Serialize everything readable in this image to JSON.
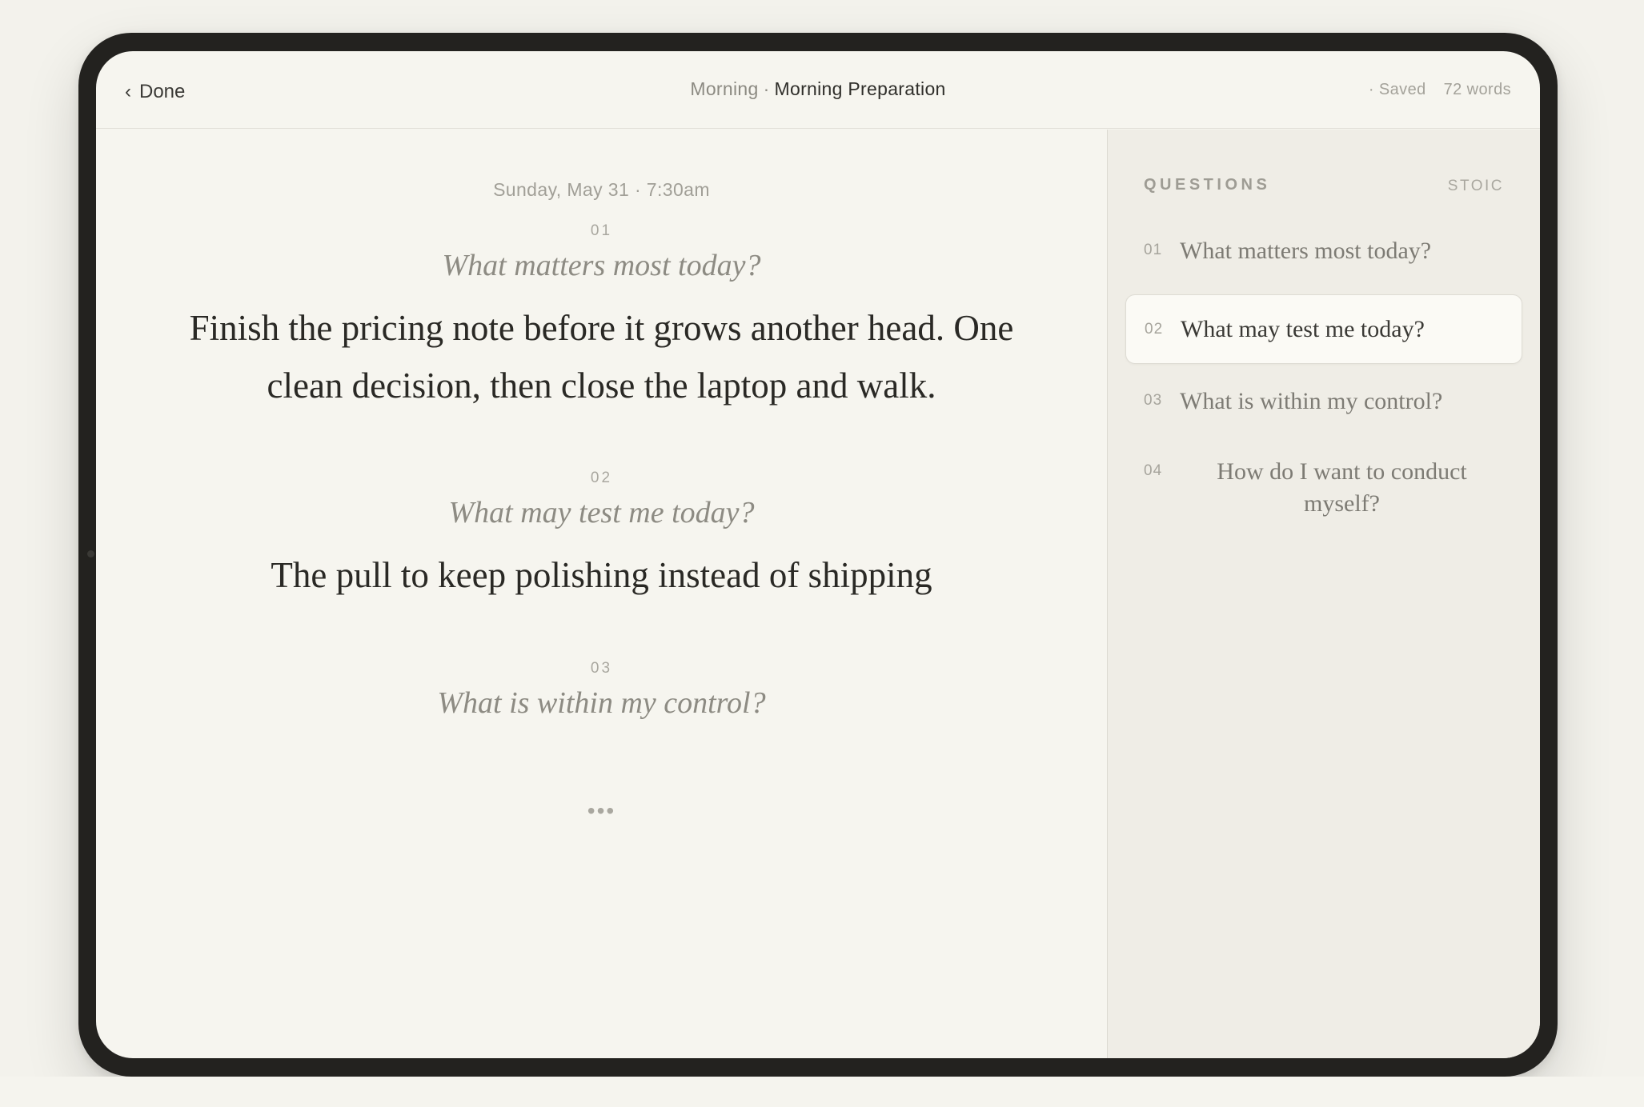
{
  "header": {
    "back_label": "Done",
    "breadcrumb_parent": "Morning",
    "breadcrumb_separator": "·",
    "breadcrumb_current": "Morning Preparation",
    "save_status": "· Saved",
    "word_count": "72 words"
  },
  "editor": {
    "date": "Sunday, May 31 · 7:30am",
    "entries": [
      {
        "number": "01",
        "prompt": "What matters most today?",
        "answer": "Finish the pricing note before it grows another head. One clean decision, then close the laptop and walk."
      },
      {
        "number": "02",
        "prompt": "What may test me today?",
        "answer": "The pull to keep polishing instead of shipping"
      },
      {
        "number": "03",
        "prompt": "What is within my control?",
        "answer": ""
      }
    ],
    "more": "•••"
  },
  "sidebar": {
    "title": "QUESTIONS",
    "tag": "STOIC",
    "active_index": 1,
    "items": [
      {
        "number": "01",
        "label": "What matters most today?"
      },
      {
        "number": "02",
        "label": "What may test me today?"
      },
      {
        "number": "03",
        "label": "What is within my control?"
      },
      {
        "number": "04",
        "label": "How do I want to conduct myself?"
      }
    ]
  }
}
